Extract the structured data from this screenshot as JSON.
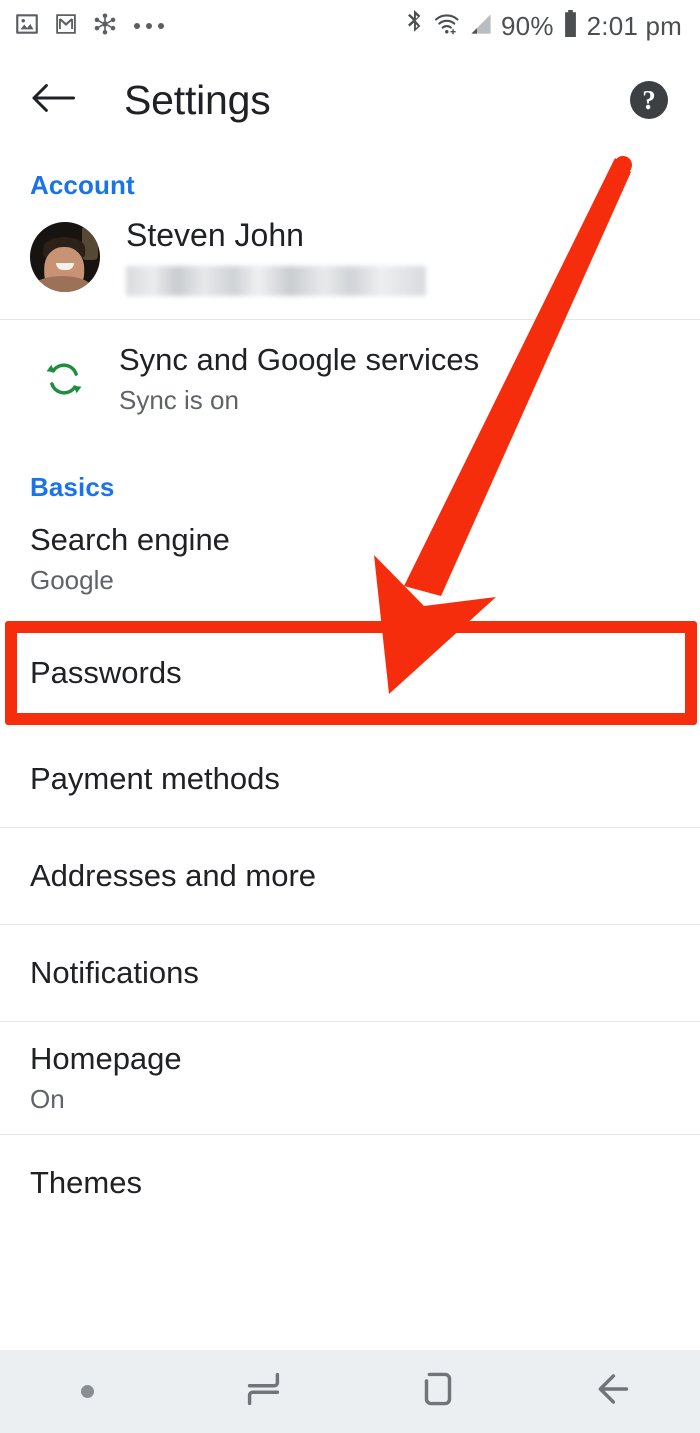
{
  "status_bar": {
    "icons_left": [
      "photos-icon",
      "gmail-icon",
      "share-nodes-icon",
      "more-dots-icon"
    ],
    "icons_right": [
      "bluetooth-icon",
      "wifi-icon",
      "cellular-signal-icon",
      "battery-icon"
    ],
    "battery_percent": "90%",
    "time": "2:01 pm"
  },
  "app_bar": {
    "back_icon": "arrow-left-icon",
    "title": "Settings",
    "help_icon": "help-question-icon",
    "help_glyph": "?"
  },
  "sections": [
    {
      "header": "Account",
      "rows": [
        {
          "type": "account",
          "name": "Steven John",
          "email_redacted": true,
          "avatar": "user-avatar-photo"
        },
        {
          "type": "icon_row",
          "icon": "sync-refresh-icon",
          "title": "Sync and Google services",
          "subtitle": "Sync is on"
        }
      ]
    },
    {
      "header": "Basics",
      "rows": [
        {
          "type": "item",
          "title": "Search engine",
          "subtitle": "Google"
        },
        {
          "type": "item",
          "title": "Passwords",
          "subtitle": "",
          "highlighted": true
        },
        {
          "type": "item",
          "title": "Payment methods",
          "subtitle": ""
        },
        {
          "type": "item",
          "title": "Addresses and more",
          "subtitle": ""
        },
        {
          "type": "item",
          "title": "Notifications",
          "subtitle": ""
        },
        {
          "type": "item",
          "title": "Homepage",
          "subtitle": "On"
        },
        {
          "type": "item",
          "title": "Themes",
          "subtitle": ""
        }
      ]
    }
  ],
  "annotation": {
    "arrow_color": "#f62d0c",
    "highlight_color": "#f62d0c",
    "arrow_points_to": "Passwords"
  },
  "nav_bar": {
    "items": [
      "pill-dot-indicator",
      "recents-icon",
      "home-icon",
      "back-icon"
    ]
  },
  "colors": {
    "section_header_blue": "#1a73e8",
    "primary_text": "#202124",
    "secondary_text": "#5f6368",
    "sync_green": "#1e8e3e",
    "divider": "#e4e6e8",
    "navbar_bg": "#eceff1"
  }
}
